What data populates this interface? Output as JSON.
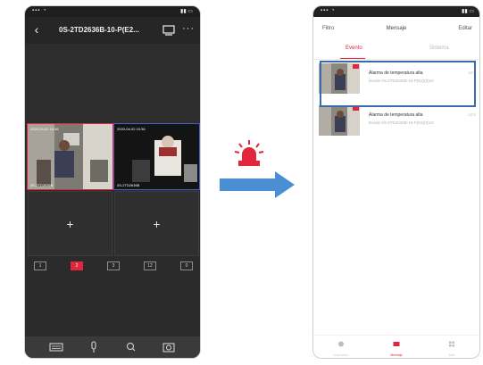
{
  "colors": {
    "accent": "#e2263c",
    "highlight": "#3b6aa8",
    "arrow": "#4a8fd4",
    "dark_bg": "#2b2b2b"
  },
  "left_phone": {
    "header_title": "0S-2TD2636B-10-P(E2...",
    "back_icon": "back-arrow-icon",
    "hd_icon": "hd-icon",
    "more_label": "···",
    "cameras": [
      {
        "time": "2020-04-02 10:36",
        "id": "0S-2TD2636B"
      },
      {
        "time": "2020-04-02 10:36",
        "id": "0S-2TD2636B"
      }
    ],
    "empty_slot_label": "+",
    "pages": [
      "1",
      "2",
      "3",
      "12",
      "0"
    ],
    "toolbar_icons": [
      "keyboard-icon",
      "microphone-icon",
      "search-icon",
      "camera-icon"
    ]
  },
  "right_phone": {
    "filter_label": "Filtro",
    "title": "Mensaje",
    "edit_label": "Editar",
    "tabs": [
      "Evento",
      "Sistema"
    ],
    "messages": [
      {
        "title": "Alarma de temperatura alta",
        "source": "Desde 0S-2TD2636B-10-P(E2)(0)10",
        "time": "10:5"
      },
      {
        "title": "Alarma de temperatura alta",
        "source": "Desde 0S-2TD2636B-10-P(E2)(0)10",
        "time": "10:5"
      }
    ],
    "nav": [
      "Dispositivo",
      "Mensaje",
      "Más"
    ]
  }
}
